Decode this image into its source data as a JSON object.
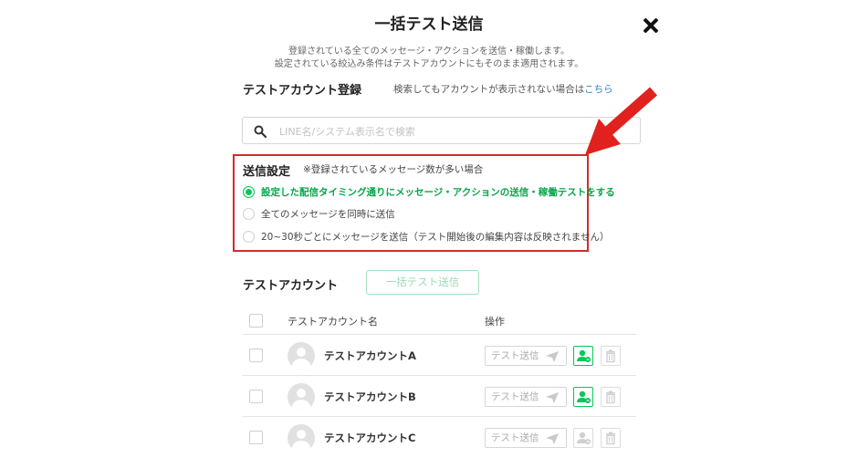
{
  "dialog": {
    "title": "一括テスト送信",
    "description_line1": "登録されている全てのメッセージ・アクションを送信・稼働します。",
    "description_line2": "設定されている絞込み条件はテストアカウントにもそのまま適用されます。"
  },
  "registration": {
    "title": "テストアカウント登録",
    "help_text": "検索してもアカウントが表示されない場合は",
    "help_link": "こちら",
    "search_placeholder": "LINE名/システム表示名で検索"
  },
  "send_settings": {
    "title": "送信設定",
    "note": "※登録されているメッセージ数が多い場合",
    "options": [
      {
        "label": "設定した配信タイミング通りにメッセージ・アクションの送信・稼働テストをする",
        "selected": true
      },
      {
        "label": "全てのメッセージを同時に送信",
        "selected": false
      },
      {
        "label": "20~30秒ごとにメッセージを送信（テスト開始後の編集内容は反映されません）",
        "selected": false
      }
    ]
  },
  "accounts": {
    "title": "テストアカウント",
    "bulk_button": "一括テスト送信",
    "columns": {
      "name": "テストアカウント名",
      "operation": "操作"
    },
    "rows": [
      {
        "name": "テストアカウントA",
        "send_label": "テスト送信",
        "user_active": true
      },
      {
        "name": "テストアカウントB",
        "send_label": "テスト送信",
        "user_active": true
      },
      {
        "name": "テストアカウントC",
        "send_label": "テスト送信",
        "user_active": false
      }
    ]
  },
  "colors": {
    "accent_green": "#06c755",
    "highlight_red": "#d42b2b",
    "link_blue": "#2b88c8"
  },
  "icons": [
    "close-icon",
    "search-icon",
    "paper-plane-icon",
    "user-add-icon",
    "trash-icon",
    "red-arrow"
  ]
}
